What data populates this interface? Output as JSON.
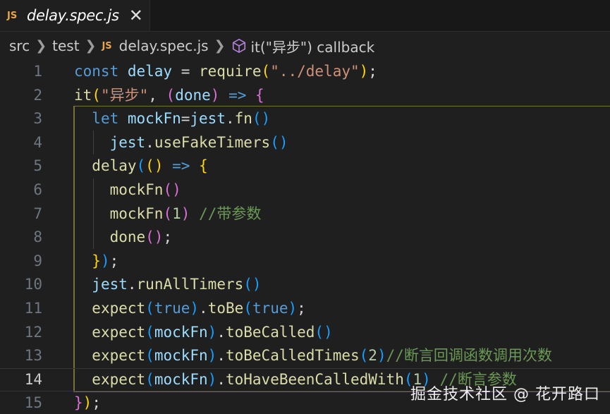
{
  "tab": {
    "js_badge": "JS",
    "filename": "delay.spec.js",
    "close_glyph": "✕"
  },
  "breadcrumb": {
    "items": [
      "src",
      "test"
    ],
    "js_badge": "JS",
    "file": "delay.spec.js",
    "symbol": "it(\"异步\") callback",
    "symbol_icon": "cube-icon"
  },
  "editor": {
    "active_line": 14,
    "lines": [
      {
        "n": "1",
        "tokens": [
          [
            "kw",
            "const "
          ],
          [
            "var",
            "delay"
          ],
          [
            "txt",
            " = "
          ],
          [
            "fn",
            "require"
          ],
          [
            "b1",
            "("
          ],
          [
            "str",
            "\"../delay\""
          ],
          [
            "b1",
            ")"
          ],
          [
            "txt",
            ";"
          ]
        ]
      },
      {
        "n": "2",
        "tokens": [
          [
            "fn",
            "it"
          ],
          [
            "b1",
            "("
          ],
          [
            "str",
            "\"异步\""
          ],
          [
            "txt",
            ", "
          ],
          [
            "b2",
            "("
          ],
          [
            "var",
            "done"
          ],
          [
            "b2",
            ")"
          ],
          [
            "txt",
            " "
          ],
          [
            "kw",
            "=>"
          ],
          [
            "txt",
            " "
          ],
          [
            "b2",
            "{"
          ]
        ]
      },
      {
        "n": "3",
        "tokens": [
          [
            "txt",
            "  "
          ],
          [
            "kw",
            "let "
          ],
          [
            "var",
            "mockFn"
          ],
          [
            "txt",
            "="
          ],
          [
            "var",
            "jest"
          ],
          [
            "txt",
            "."
          ],
          [
            "fn",
            "fn"
          ],
          [
            "b3",
            "()"
          ]
        ]
      },
      {
        "n": "4",
        "tokens": [
          [
            "txt",
            "    "
          ],
          [
            "var",
            "jest"
          ],
          [
            "txt",
            "."
          ],
          [
            "fn",
            "useFakeTimers"
          ],
          [
            "b3",
            "()"
          ]
        ]
      },
      {
        "n": "5",
        "tokens": [
          [
            "txt",
            "  "
          ],
          [
            "fn",
            "delay"
          ],
          [
            "b3",
            "("
          ],
          [
            "b1",
            "()"
          ],
          [
            "txt",
            " "
          ],
          [
            "kw",
            "=>"
          ],
          [
            "txt",
            " "
          ],
          [
            "b1",
            "{"
          ]
        ]
      },
      {
        "n": "6",
        "tokens": [
          [
            "txt",
            "    "
          ],
          [
            "fn",
            "mockFn"
          ],
          [
            "b2",
            "()"
          ]
        ]
      },
      {
        "n": "7",
        "tokens": [
          [
            "txt",
            "    "
          ],
          [
            "fn",
            "mockFn"
          ],
          [
            "b2",
            "("
          ],
          [
            "num",
            "1"
          ],
          [
            "b2",
            ")"
          ],
          [
            "txt",
            " "
          ],
          [
            "cm",
            "//带参数"
          ]
        ]
      },
      {
        "n": "8",
        "tokens": [
          [
            "txt",
            "    "
          ],
          [
            "fn",
            "done"
          ],
          [
            "b2",
            "()"
          ],
          [
            "txt",
            ";"
          ]
        ]
      },
      {
        "n": "9",
        "tokens": [
          [
            "txt",
            "  "
          ],
          [
            "b1",
            "}"
          ],
          [
            "b3",
            ")"
          ],
          [
            "txt",
            ";"
          ]
        ]
      },
      {
        "n": "10",
        "tokens": [
          [
            "txt",
            "  "
          ],
          [
            "var",
            "jest"
          ],
          [
            "txt",
            "."
          ],
          [
            "fn",
            "runAllTimers"
          ],
          [
            "b3",
            "()"
          ]
        ]
      },
      {
        "n": "11",
        "tokens": [
          [
            "txt",
            "  "
          ],
          [
            "fn",
            "expect"
          ],
          [
            "b3",
            "("
          ],
          [
            "kw",
            "true"
          ],
          [
            "b3",
            ")"
          ],
          [
            "txt",
            "."
          ],
          [
            "fn",
            "toBe"
          ],
          [
            "b3",
            "("
          ],
          [
            "kw",
            "true"
          ],
          [
            "b3",
            ")"
          ],
          [
            "txt",
            ";"
          ]
        ]
      },
      {
        "n": "12",
        "tokens": [
          [
            "txt",
            "  "
          ],
          [
            "fn",
            "expect"
          ],
          [
            "b3",
            "("
          ],
          [
            "var",
            "mockFn"
          ],
          [
            "b3",
            ")"
          ],
          [
            "txt",
            "."
          ],
          [
            "fn",
            "toBeCalled"
          ],
          [
            "b3",
            "()"
          ]
        ]
      },
      {
        "n": "13",
        "tokens": [
          [
            "txt",
            "  "
          ],
          [
            "fn",
            "expect"
          ],
          [
            "b3",
            "("
          ],
          [
            "var",
            "mockFn"
          ],
          [
            "b3",
            ")"
          ],
          [
            "txt",
            "."
          ],
          [
            "fn",
            "toBeCalledTimes"
          ],
          [
            "b3",
            "("
          ],
          [
            "num",
            "2"
          ],
          [
            "b3",
            ")"
          ],
          [
            "cm",
            "//断言回调函数调用次数"
          ]
        ]
      },
      {
        "n": "14",
        "tokens": [
          [
            "txt",
            "  "
          ],
          [
            "fn",
            "expect"
          ],
          [
            "b3",
            "("
          ],
          [
            "var",
            "mockFn"
          ],
          [
            "b3",
            ")"
          ],
          [
            "txt",
            "."
          ],
          [
            "fn",
            "toHaveBeenCalledWith"
          ],
          [
            "b3",
            "("
          ],
          [
            "num",
            "1"
          ],
          [
            "b3",
            ")"
          ],
          [
            "txt",
            " "
          ],
          [
            "cm",
            "//断言参数"
          ]
        ]
      },
      {
        "n": "15",
        "tokens": [
          [
            "b2",
            "}"
          ],
          [
            "b1",
            ")"
          ],
          [
            "txt",
            ";"
          ]
        ]
      }
    ]
  },
  "watermark": "掘金技术社区 @ 花开路口",
  "colors": {
    "background": "#1f1f1f",
    "keyword": "#569cd6",
    "function": "#dcdcaa",
    "variable": "#9cdcfe",
    "string": "#ce9178",
    "number": "#b5cea8",
    "comment": "#6a9955",
    "js_badge": "#e8a64c"
  }
}
